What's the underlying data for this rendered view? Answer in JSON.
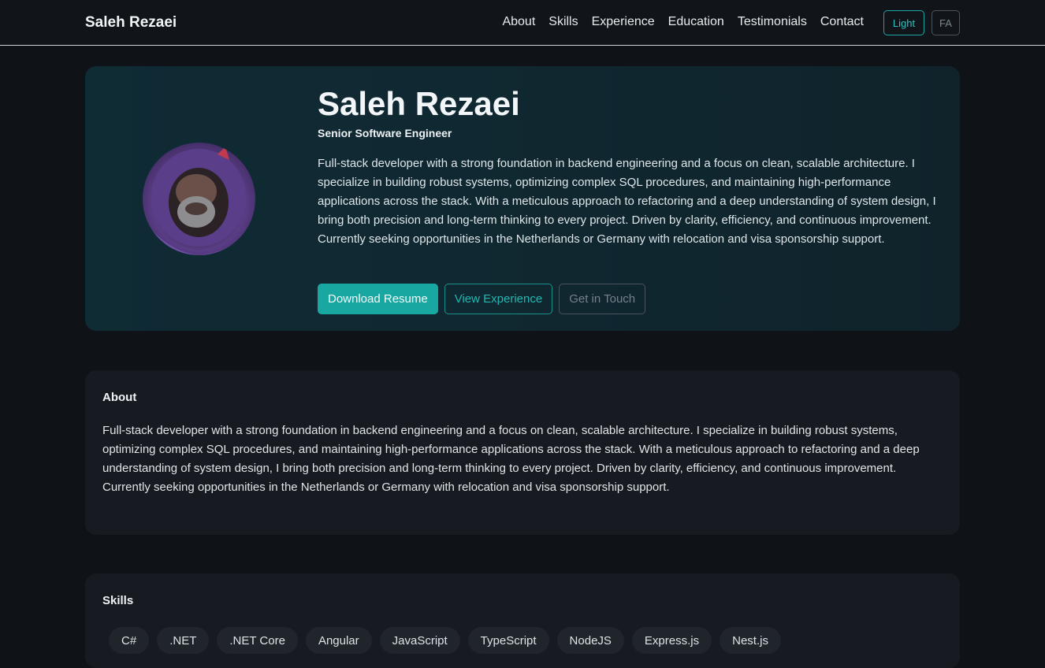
{
  "header": {
    "brand": "Saleh Rezaei",
    "nav": [
      "About",
      "Skills",
      "Experience",
      "Education",
      "Testimonials",
      "Contact"
    ],
    "theme_toggle": "Light",
    "lang_toggle": "FA"
  },
  "hero": {
    "name": "Saleh Rezaei",
    "title": "Senior Software Engineer",
    "bio": "Full-stack developer with a strong foundation in backend engineering and a focus on clean, scalable architecture. I specialize in building robust systems, optimizing complex SQL procedures, and maintaining high-performance applications across the stack. With a meticulous approach to refactoring and a deep understanding of system design, I bring both precision and long-term thinking to every project. Driven by clarity, efficiency, and continuous improvement. Currently seeking opportunities in the Netherlands or Germany with relocation and visa sponsorship support.",
    "buttons": {
      "download": "Download Resume",
      "experience": "View Experience",
      "contact": "Get in Touch"
    }
  },
  "about": {
    "heading": "About",
    "text": "Full-stack developer with a strong foundation in backend engineering and a focus on clean, scalable architecture. I specialize in building robust systems, optimizing complex SQL procedures, and maintaining high-performance applications across the stack. With a meticulous approach to refactoring and a deep understanding of system design, I bring both precision and long-term thinking to every project. Driven by clarity, efficiency, and continuous improvement. Currently seeking opportunities in the Netherlands or Germany with relocation and visa sponsorship support."
  },
  "skills": {
    "heading": "Skills",
    "items": [
      "C#",
      ".NET",
      ".NET Core",
      "Angular",
      "JavaScript",
      "TypeScript",
      "NodeJS",
      "Express.js",
      "Nest.js"
    ]
  },
  "colors": {
    "accent": "#19a7a2",
    "background": "#0f1216",
    "card": "#171b21",
    "hero": "#0f2b34"
  }
}
